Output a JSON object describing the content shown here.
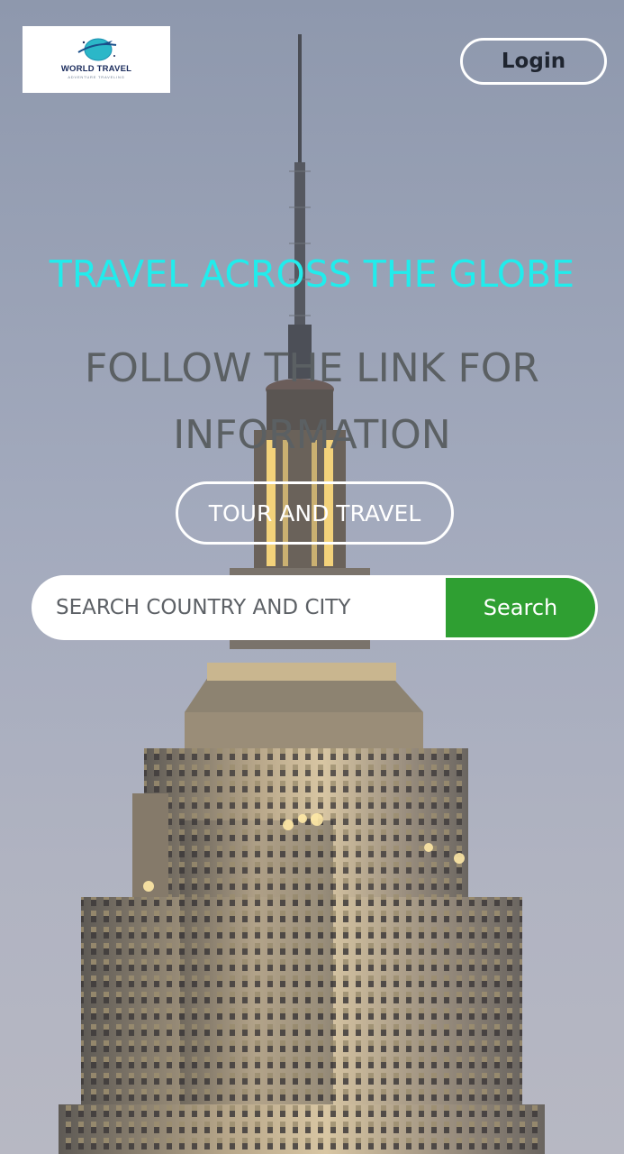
{
  "brand": {
    "logo_text": "WORLD TRAVEL",
    "logo_tagline": "ADVENTURE TRAVELING"
  },
  "header": {
    "login_label": "Login"
  },
  "hero": {
    "headline": "TRAVEL ACROSS THE GLOBE",
    "subheadline": "FOLLOW THE LINK FOR INFORMATION",
    "cta_label": "TOUR AND TRAVEL",
    "headline_color": "#21ecec"
  },
  "search": {
    "placeholder": "SEARCH COUNTRY AND CITY",
    "button_label": "Search",
    "button_color": "#2f9f32"
  },
  "background": {
    "subject": "skyscraper-at-dusk"
  }
}
